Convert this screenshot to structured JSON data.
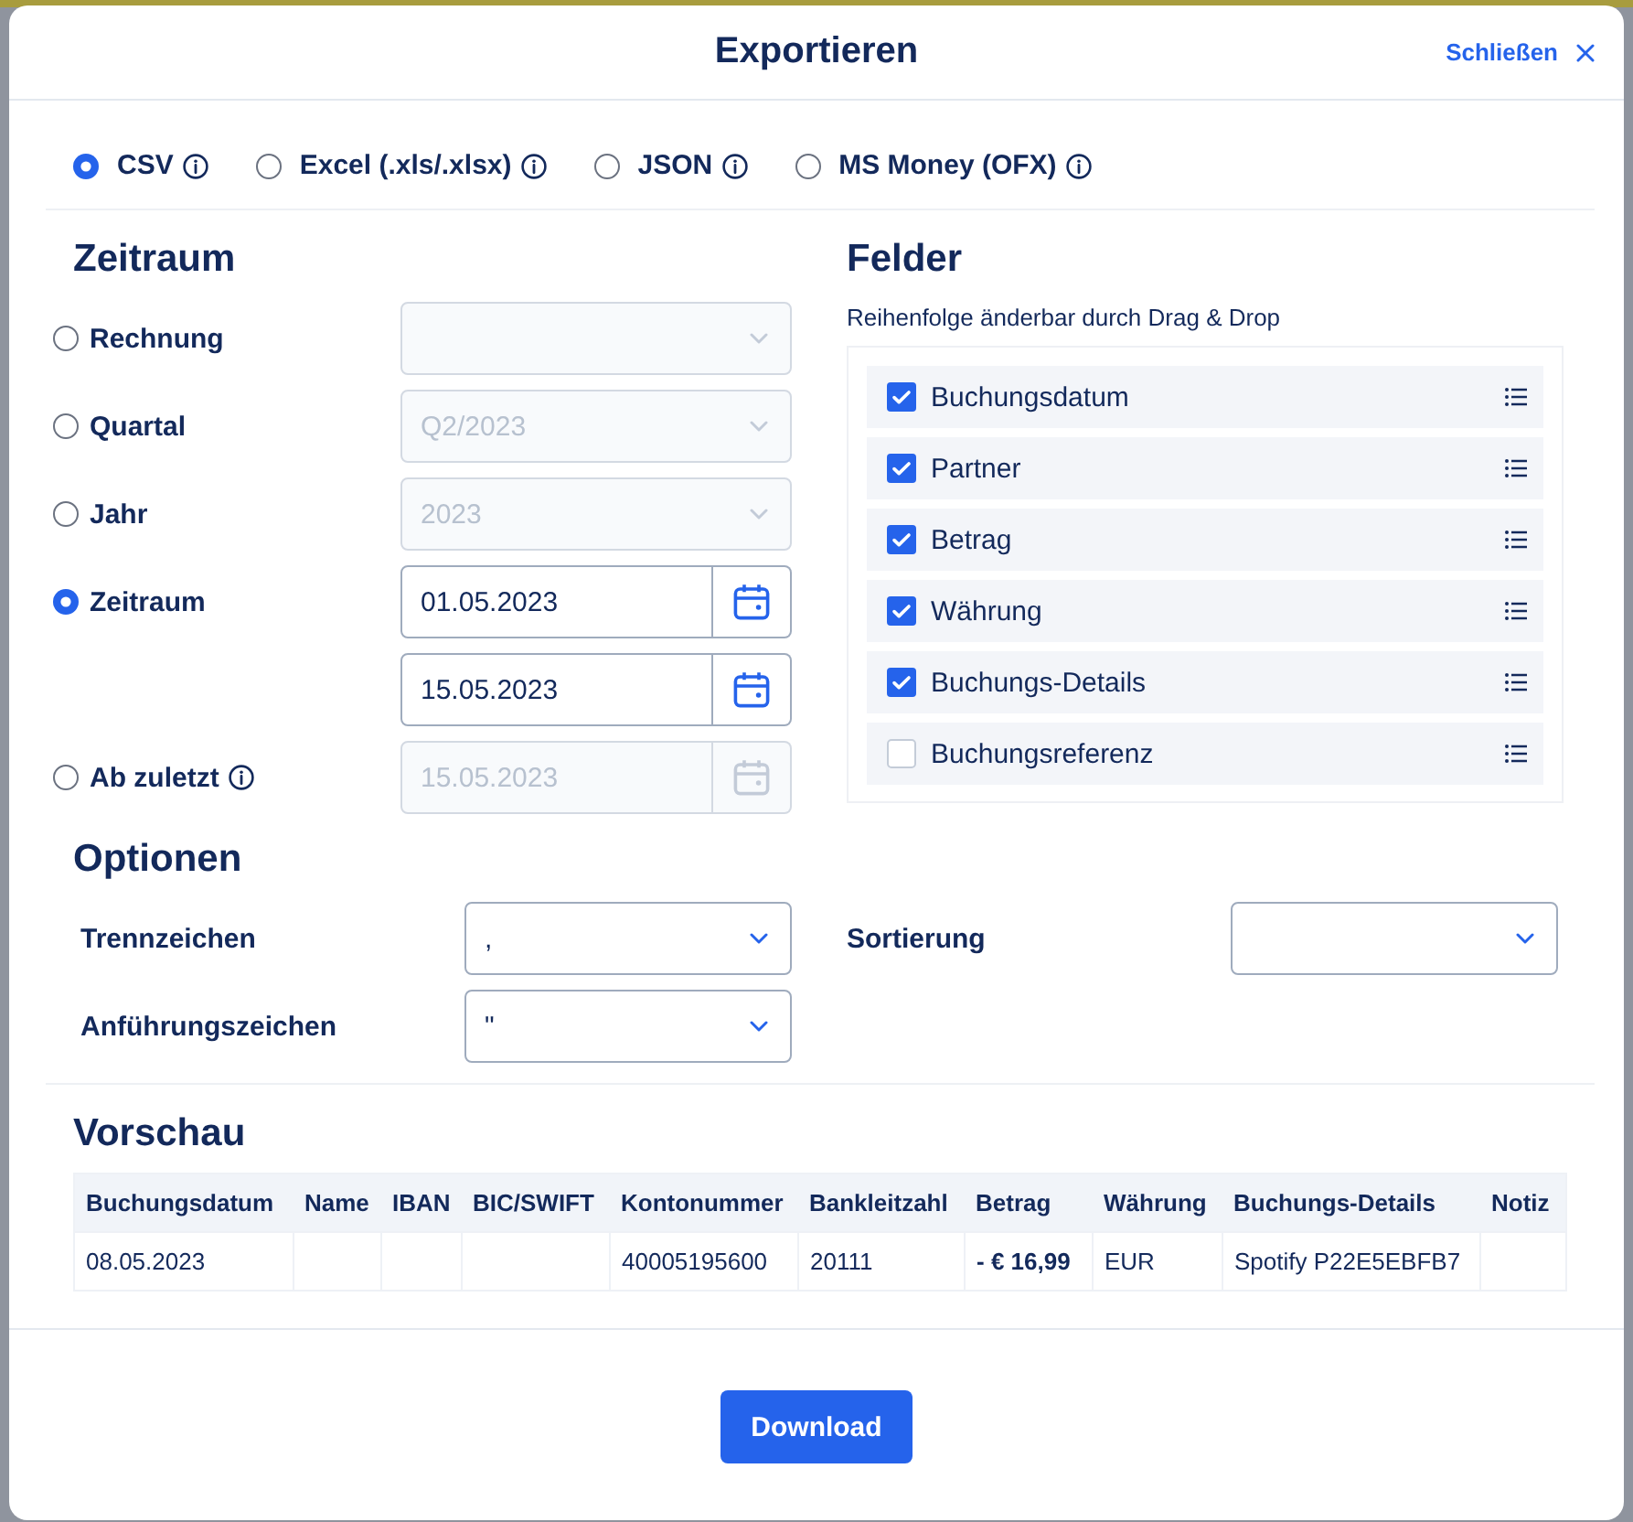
{
  "dialog": {
    "title": "Exportieren",
    "close_label": "Schließen"
  },
  "formats": [
    {
      "label": "CSV",
      "selected": true,
      "info": true
    },
    {
      "label": "Excel (.xls/.xlsx)",
      "selected": false,
      "info": true
    },
    {
      "label": "JSON",
      "selected": false,
      "info": true
    },
    {
      "label": "MS Money (OFX)",
      "selected": false,
      "info": true
    }
  ],
  "period": {
    "heading": "Zeitraum",
    "options": [
      {
        "label": "Rechnung",
        "selected": false,
        "info": false,
        "fields": [
          {
            "kind": "select",
            "disabled": true
          }
        ]
      },
      {
        "label": "Quartal",
        "selected": false,
        "info": false,
        "fields": [
          {
            "kind": "select",
            "value": "Q2/2023",
            "disabled": true
          }
        ]
      },
      {
        "label": "Jahr",
        "selected": false,
        "info": false,
        "fields": [
          {
            "kind": "select",
            "value": "2023",
            "disabled": true
          }
        ]
      },
      {
        "label": "Zeitraum",
        "selected": true,
        "info": false,
        "fields": [
          {
            "kind": "date",
            "value": "01.05.2023",
            "disabled": false
          },
          {
            "kind": "date",
            "value": "15.05.2023",
            "disabled": false
          }
        ]
      },
      {
        "label": "Ab zuletzt",
        "selected": false,
        "info": true,
        "fields": [
          {
            "kind": "date",
            "value": "15.05.2023",
            "disabled": true
          }
        ]
      }
    ]
  },
  "fields": {
    "heading": "Felder",
    "hint": "Reihenfolge änderbar durch Drag & Drop",
    "items": [
      {
        "label": "Buchungsdatum",
        "checked": true
      },
      {
        "label": "Partner",
        "checked": true
      },
      {
        "label": "Betrag",
        "checked": true
      },
      {
        "label": "Währung",
        "checked": true
      },
      {
        "label": "Buchungs-Details",
        "checked": true
      },
      {
        "label": "Buchungsreferenz",
        "checked": false
      }
    ]
  },
  "options": {
    "heading": "Optionen",
    "columns": [
      {
        "settings": [
          {
            "label": "Trennzeichen",
            "value": ","
          },
          {
            "label": "Anführungszeichen",
            "value": "\""
          }
        ]
      },
      {
        "settings": [
          {
            "label": "Sortierung"
          }
        ]
      }
    ]
  },
  "preview": {
    "heading": "Vorschau",
    "columns": [
      "Buchungsdatum",
      "Name",
      "IBAN",
      "BIC/SWIFT",
      "Kontonummer",
      "Bankleitzahl",
      "Betrag",
      "Währung",
      "Buchungs-Details",
      "Notiz"
    ],
    "rows": [
      {
        "cells": [
          {
            "text": "08.05.2023",
            "bold": false
          },
          null,
          null,
          null,
          {
            "text": "40005195600",
            "bold": false
          },
          {
            "text": "20111",
            "bold": false
          },
          {
            "text": "- € 16,99",
            "bold": true
          },
          {
            "text": "EUR",
            "bold": false
          },
          {
            "text": "Spotify P22E5EBFB7",
            "bold": false
          },
          null
        ]
      }
    ]
  },
  "footer": {
    "download_label": "Download"
  }
}
